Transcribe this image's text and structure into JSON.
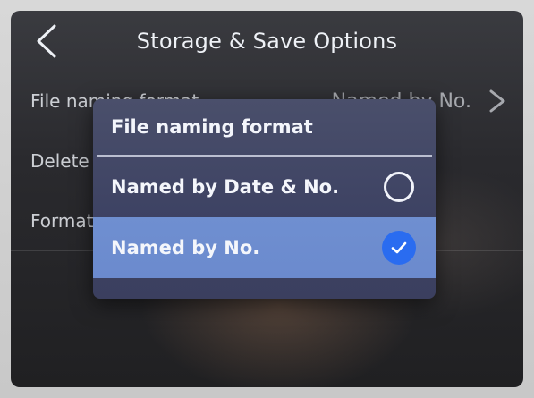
{
  "header": {
    "title": "Storage & Save Options"
  },
  "settings": {
    "items": [
      {
        "label": "File naming format",
        "value": "Named by No."
      },
      {
        "label": "Delete"
      },
      {
        "label": "Format"
      }
    ]
  },
  "dialog": {
    "title": "File naming format",
    "options": [
      {
        "label": "Named by Date & No.",
        "selected": false
      },
      {
        "label": "Named by No.",
        "selected": true
      }
    ]
  },
  "icons": {
    "back": "chevron-left-icon",
    "row_chevron": "chevron-right-icon",
    "radio_unselected": "radio-empty-icon",
    "radio_selected": "check-circle-icon"
  },
  "colors": {
    "dialog_bg": "#3d4263",
    "selected_row_bg": "#6f8fd0",
    "check_blue": "#2a6cf0"
  }
}
